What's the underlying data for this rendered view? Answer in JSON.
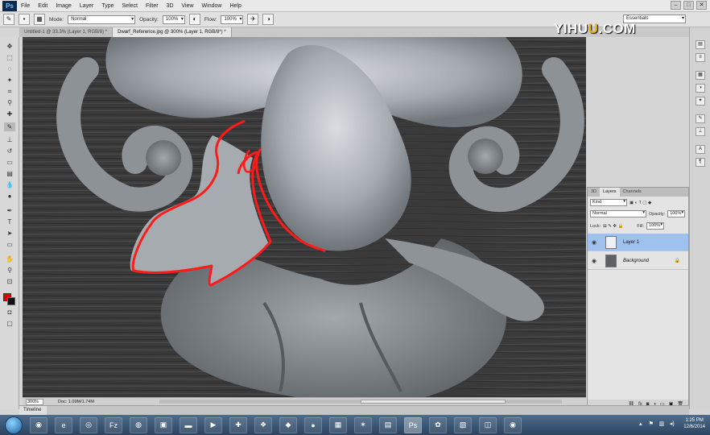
{
  "app": {
    "logo": "Ps"
  },
  "watermark": {
    "prefix": "YIHU",
    "highlight": "U",
    "suffix": ".COM"
  },
  "menu": [
    "File",
    "Edit",
    "Image",
    "Layer",
    "Type",
    "Select",
    "Filter",
    "3D",
    "View",
    "Window",
    "Help"
  ],
  "options": {
    "mode_label": "Mode:",
    "mode_value": "Normal",
    "opacity_label": "Opacity:",
    "opacity_value": "100%",
    "flow_label": "Flow:",
    "flow_value": "100%",
    "workspace": "Essentials"
  },
  "tabs": [
    {
      "label": "Untitled-1 @ 33.3% (Layer 1, RGB/8) *",
      "active": false
    },
    {
      "label": "Dwarf_Reference.jpg @ 300% (Layer 1, RGB/8*) *",
      "active": true
    }
  ],
  "status": {
    "zoom": "300%",
    "doc": "Doc: 1.09M/1.74M"
  },
  "layers_panel": {
    "tabs": [
      "3D",
      "Layers",
      "Channels"
    ],
    "active_tab": "Layers",
    "kind_filter": "Kind",
    "blend_mode": "Normal",
    "opacity_label": "Opacity:",
    "opacity_value": "100%",
    "lock_label": "Lock:",
    "fill_label": "Fill:",
    "fill_value": "100%",
    "layers": [
      {
        "name": "Layer 1",
        "selected": true,
        "italic": false
      },
      {
        "name": "Background",
        "selected": false,
        "italic": true
      }
    ]
  },
  "timeline": {
    "label": "Timeline"
  },
  "taskbar": {
    "apps": [
      "chrome-icon",
      "firefox-icon",
      "ie-icon",
      "chrome-icon",
      "filezilla-icon",
      "swirl-icon",
      "app-icon",
      "folder-icon",
      "media-player-icon",
      "camtasia-icon",
      "dropbox-icon",
      "app-icon",
      "app-icon",
      "app-icon",
      "app-icon",
      "photoshop-icon",
      "app-icon",
      "app-icon",
      "app-icon"
    ],
    "active_index": 15,
    "clock_time": "1:25 PM",
    "clock_date": "12/6/2014"
  },
  "colors": {
    "foreground": "#e00000",
    "background": "#111111",
    "selection_outline": "#ff1a1a",
    "accent": "#9fc1ee"
  }
}
